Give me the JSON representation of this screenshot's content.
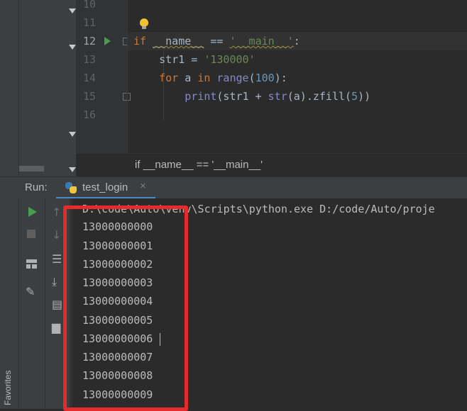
{
  "editor": {
    "line_numbers": [
      "10",
      "11",
      "12",
      "13",
      "14",
      "15",
      "16"
    ],
    "current_line": "12",
    "code": {
      "line12": {
        "kw_if": "if ",
        "name_var": "__name__",
        "eq": " == ",
        "main_str": "'__main__'",
        "colon": ":"
      },
      "line13": {
        "indent": "    ",
        "var": "str1 = ",
        "value": "'130000'"
      },
      "line14": {
        "indent": "    ",
        "kw_for": "for",
        "mid": " a ",
        "kw_in": "in",
        "space": " ",
        "func": "range",
        "open": "(",
        "num": "100",
        "close": "):"
      },
      "line15": {
        "indent": "        ",
        "func": "print",
        "arg1": "(str1 + ",
        "func2": "str",
        "arg2": "(a).zfill(",
        "num": "5",
        "close": "))"
      }
    },
    "breadcrumb": "if __name__ == '__main__'"
  },
  "run_panel": {
    "label": "Run:",
    "tab_title": "test_login",
    "tab_close": "×",
    "command": "D:\\code\\Auto\\venv\\Scripts\\python.exe D:/code/Auto/proje",
    "output_lines": [
      "13000000000",
      "13000000001",
      "13000000002",
      "13000000003",
      "13000000004",
      "13000000005",
      "13000000006",
      "13000000007",
      "13000000008",
      "13000000009"
    ]
  },
  "sidebar": {
    "favorites_label": "Favorites"
  },
  "icons": {
    "run": "play-icon",
    "stop": "stop-icon",
    "layout": "layout-icon",
    "pin": "pin-icon",
    "up": "arrow-up-icon",
    "down": "arrow-down-icon",
    "wrap": "soft-wrap-icon",
    "scroll_end": "scroll-to-end-icon",
    "print": "print-icon",
    "trash": "trash-icon"
  },
  "colors": {
    "highlight": "#e52b2b",
    "keyword": "#cc7832",
    "string": "#6a8759",
    "number": "#6897bb",
    "builtin": "#8888c6",
    "run_green": "#499c54",
    "tab_underline": "#4a88c7"
  }
}
